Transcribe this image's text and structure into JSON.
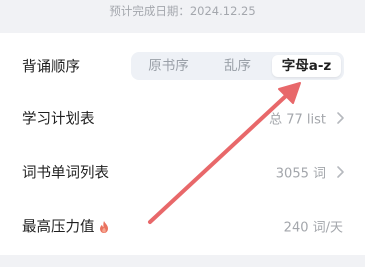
{
  "header": {
    "completion_note": "预计完成日期：2024.12.25"
  },
  "settings": {
    "order": {
      "label": "背诵顺序",
      "options": [
        "原书序",
        "乱序",
        "字母a-z"
      ],
      "selected_index": 2
    },
    "study_plan": {
      "label": "学习计划表",
      "value": "总 77 list"
    },
    "word_list": {
      "label": "词书单词列表",
      "value": "3055 词"
    },
    "max_pressure": {
      "label": "最高压力值",
      "value": "240 词/天"
    }
  },
  "colors": {
    "annotation_arrow": "#e8686a",
    "flame": "#e9725f",
    "segmented_bg": "#eef1f6"
  },
  "icons": {
    "chevron": "chevron-right-icon",
    "flame": "flame-icon"
  }
}
